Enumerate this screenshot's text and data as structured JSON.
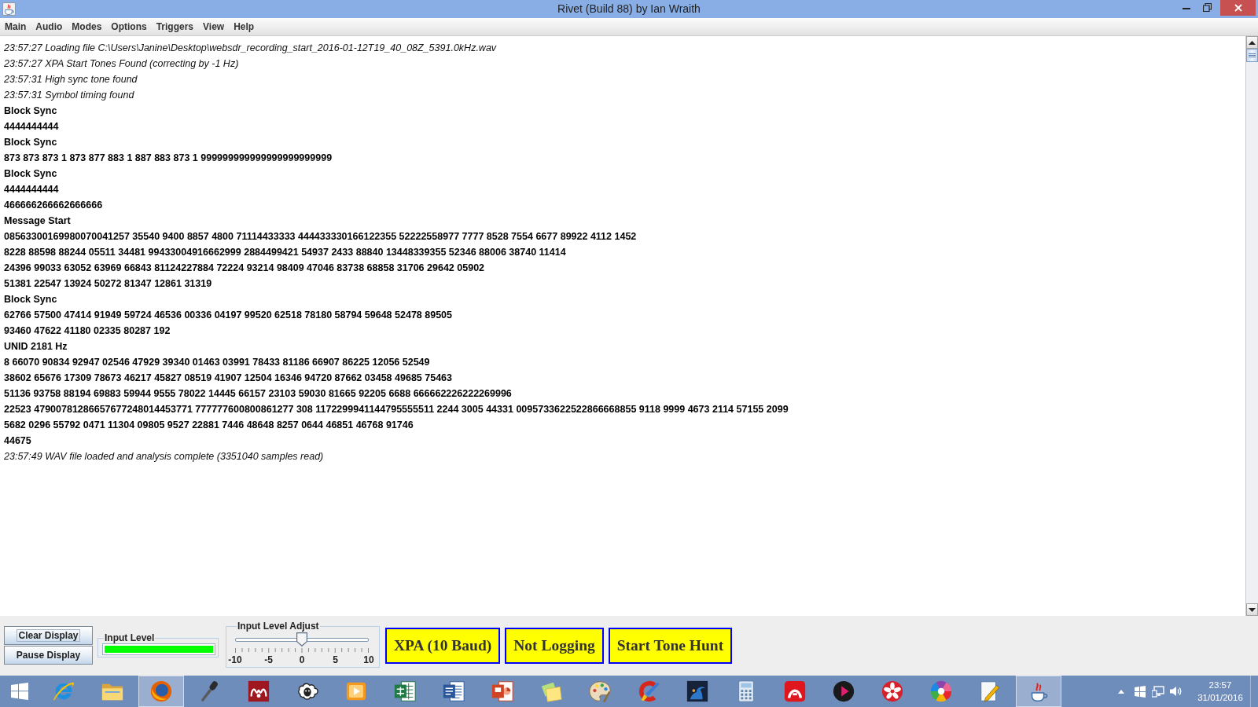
{
  "window": {
    "title": "Rivet (Build 88) by Ian Wraith"
  },
  "menu_bar": [
    "Main",
    "Audio",
    "Modes",
    "Options",
    "Triggers",
    "View",
    "Help"
  ],
  "log": [
    {
      "kind": "status",
      "text": "23:57:27 Loading file C:\\Users\\Janine\\Desktop\\websdr_recording_start_2016-01-12T19_40_08Z_5391.0kHz.wav"
    },
    {
      "kind": "status",
      "text": "23:57:27 XPA Start Tones Found (correcting by -1 Hz)"
    },
    {
      "kind": "status",
      "text": "23:57:31 High sync tone found"
    },
    {
      "kind": "status",
      "text": "23:57:31 Symbol timing found"
    },
    {
      "kind": "data",
      "text": "Block Sync"
    },
    {
      "kind": "data",
      "text": "4444444444"
    },
    {
      "kind": "data",
      "text": "Block Sync"
    },
    {
      "kind": "data",
      "text": "873 873 873 1 873 877 883 1 887 883 873 1 999999999999999999999999"
    },
    {
      "kind": "data",
      "text": "Block Sync"
    },
    {
      "kind": "data",
      "text": "4444444444"
    },
    {
      "kind": "data",
      "text": "466666266662666666"
    },
    {
      "kind": "data",
      "text": "Message Start"
    },
    {
      "kind": "data",
      "text": "08563300169980070041257 35540 9400 8857 4800 71114433333 444433330166122355 52222558977 7777 8528 7554 6677 89922 4112 1452"
    },
    {
      "kind": "data",
      "text": "8228 88598 88244 05511 34481 99433004916662999 2884499421 54937 2433 88840 13448339355 52346 88006 38740 11414"
    },
    {
      "kind": "data",
      "text": "24396 99033 63052 63969 66843 81124227884 72224 93214 98409 47046 83738 68858 31706 29642 05902"
    },
    {
      "kind": "data",
      "text": "51381 22547 13924 50272 81347 12861 31319"
    },
    {
      "kind": "data",
      "text": "Block Sync"
    },
    {
      "kind": "data",
      "text": "62766 57500 47414 91949 59724 46536 00336 04197 99520 62518 78180 58794 59648 52478 89505"
    },
    {
      "kind": "data",
      "text": "93460 47622 41180 02335 80287 192"
    },
    {
      "kind": "data",
      "text": "UNID 2181 Hz"
    },
    {
      "kind": "data",
      "text": "8 66070 90834 92947 02546 47929 39340 01463 03991 78433 81186 66907 86225 12056 52549"
    },
    {
      "kind": "data",
      "text": "38602 65676 17309 78673 46217 45827 08519 41907 12504 16346 94720 87662 03458 49685 75463"
    },
    {
      "kind": "data",
      "text": "51136 93758 88194 69883 59944 9555 78022 14445 66157 23103 59030 81665 92205 6688 666662226222269996"
    },
    {
      "kind": "data",
      "text": "22523 47900781286657677248014453771 777777600800861277 308 1172299941144795555511 2244 3005 44331 0095733622522866668855 9118 9999 4673 2114 57155 2099"
    },
    {
      "kind": "data",
      "text": "5682 0296 55792 0471 11304 09805 9527 22881 7446 48648 8257 0644 46851 46768 91746"
    },
    {
      "kind": "data",
      "text": "44675"
    },
    {
      "kind": "status",
      "text": "23:57:49 WAV file loaded and analysis complete (3351040 samples read)"
    }
  ],
  "controls": {
    "display_buttons": [
      {
        "label": "Clear Display",
        "focused": true
      },
      {
        "label": "Pause Display",
        "focused": false
      }
    ],
    "input_level": {
      "title": "Input Level",
      "level": 1
    },
    "level_adjust": {
      "title": "Input Level Adjust",
      "level": 0.5,
      "tick_labels": [
        "-10",
        "-5",
        "0",
        "5",
        "10"
      ]
    },
    "mode_buttons": [
      "XPA (10 Baud)",
      "Not Logging",
      "Start Tone Hunt"
    ]
  },
  "taskbar": {
    "apps": [
      {
        "kind": "ring",
        "selected": false
      },
      {
        "kind": "folder",
        "selected": false
      },
      {
        "kind": "globe",
        "selected": true
      },
      {
        "kind": "microphone",
        "selected": false
      },
      {
        "kind": "wave",
        "selected": false
      },
      {
        "kind": "sheep",
        "selected": false
      },
      {
        "kind": "play",
        "selected": false
      },
      {
        "kind": "sheet",
        "selected": false
      },
      {
        "kind": "document",
        "selected": false
      },
      {
        "kind": "slides",
        "selected": false
      },
      {
        "kind": "notes",
        "selected": false
      },
      {
        "kind": "palette",
        "selected": false
      },
      {
        "kind": "brush",
        "selected": false
      },
      {
        "kind": "reader",
        "selected": false
      },
      {
        "kind": "calculator",
        "selected": false
      },
      {
        "kind": "arch",
        "selected": false
      },
      {
        "kind": "playcircle",
        "selected": false
      },
      {
        "kind": "flower",
        "selected": false
      },
      {
        "kind": "wheel",
        "selected": false
      },
      {
        "kind": "pen",
        "selected": false
      },
      {
        "kind": "cup",
        "selected": true
      }
    ],
    "clock": {
      "time": "23:57",
      "date": "31/01/2016"
    }
  }
}
